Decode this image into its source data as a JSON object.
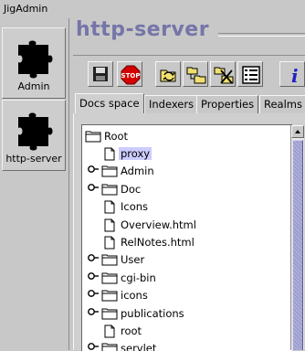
{
  "window": {
    "title": "JigAdmin"
  },
  "services": [
    {
      "label": "Admin",
      "icon": "puzzle-icon"
    },
    {
      "label": "http-server",
      "icon": "puzzle-icon"
    }
  ],
  "header": {
    "title": "http-server"
  },
  "toolbar": {
    "buttons": [
      {
        "icon": "save-icon"
      },
      {
        "icon": "stop-icon",
        "text": "STOP"
      },
      {
        "icon": "reload-folders-icon"
      },
      {
        "icon": "add-folder-icon"
      },
      {
        "icon": "delete-folder-icon"
      },
      {
        "icon": "properties-list-icon"
      },
      {
        "icon": "info-icon",
        "text": "i"
      }
    ]
  },
  "tabs": [
    {
      "label": "Docs space",
      "active": true
    },
    {
      "label": "Indexers"
    },
    {
      "label": "Properties"
    },
    {
      "label": "Realms"
    }
  ],
  "tree": {
    "root": "Root",
    "items": [
      {
        "label": "proxy",
        "type": "file",
        "selected": true
      },
      {
        "label": "Admin",
        "type": "folder",
        "expandable": true
      },
      {
        "label": "Doc",
        "type": "folder",
        "expandable": true
      },
      {
        "label": "Icons",
        "type": "file"
      },
      {
        "label": "Overview.html",
        "type": "file"
      },
      {
        "label": "RelNotes.html",
        "type": "file"
      },
      {
        "label": "User",
        "type": "folder",
        "expandable": true
      },
      {
        "label": "cgi-bin",
        "type": "folder",
        "expandable": true
      },
      {
        "label": "icons",
        "type": "folder",
        "expandable": true
      },
      {
        "label": "publications",
        "type": "folder",
        "expandable": true
      },
      {
        "label": "root",
        "type": "file"
      },
      {
        "label": "servlet",
        "type": "folder",
        "expandable": true
      }
    ]
  },
  "colors": {
    "title": "#7575a8",
    "selection": "#ccccff",
    "scroll_thumb": "#9d9dd0",
    "folder_fill": "#ffffff"
  }
}
